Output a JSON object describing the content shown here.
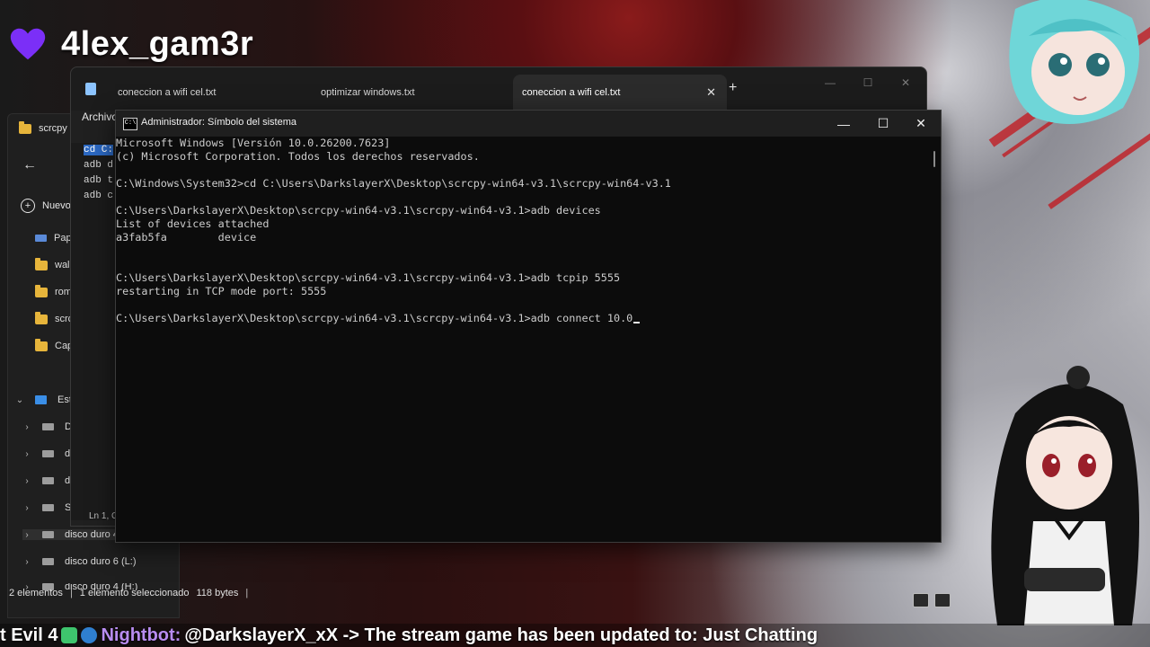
{
  "stream": {
    "streamer_name": "4lex_gam3r",
    "heart_color": "#7b2ff7"
  },
  "explorer": {
    "tab_label": "scrcpy",
    "new_label": "Nuevo",
    "quick_items": [
      "Pap",
      "wall",
      "rom",
      "scrc",
      "Cap"
    ],
    "this_pc_label": "Este",
    "drives": [
      "Di",
      "dis",
      "dis",
      "SS",
      "disco duro 4",
      "disco duro 6 (L:)",
      "disco duro 4 (H:)"
    ],
    "status": {
      "count": "2 elementos",
      "selected": "1 elemento seleccionado",
      "size": "118 bytes"
    }
  },
  "notepad": {
    "tabs": [
      {
        "label": "coneccion a wifi cel.txt"
      },
      {
        "label": "optimizar windows.txt"
      },
      {
        "label": "coneccion a wifi cel.txt"
      }
    ],
    "menu_label": "Archivo",
    "lines": [
      "cd C:",
      "adb d",
      "adb t",
      "adb c"
    ],
    "status_pos": "Ln 1, C"
  },
  "cmd": {
    "title": "Administrador: Símbolo del sistema",
    "lines": [
      "Microsoft Windows [Versión 10.0.26200.7623]",
      "(c) Microsoft Corporation. Todos los derechos reservados.",
      "",
      "C:\\Windows\\System32>cd C:\\Users\\DarkslayerX\\Desktop\\scrcpy-win64-v3.1\\scrcpy-win64-v3.1",
      "",
      "C:\\Users\\DarkslayerX\\Desktop\\scrcpy-win64-v3.1\\scrcpy-win64-v3.1>adb devices",
      "List of devices attached",
      "a3fab5fa        device",
      "",
      "",
      "C:\\Users\\DarkslayerX\\Desktop\\scrcpy-win64-v3.1\\scrcpy-win64-v3.1>adb tcpip 5555",
      "restarting in TCP mode port: 5555",
      "",
      "C:\\Users\\DarkslayerX\\Desktop\\scrcpy-win64-v3.1\\scrcpy-win64-v3.1>adb connect 10.0"
    ]
  },
  "ticker": {
    "prefix": "t Evil 4",
    "user": "Nightbot:",
    "message": "@DarkslayerX_xX -> The stream game has been updated to: Just Chatting"
  }
}
